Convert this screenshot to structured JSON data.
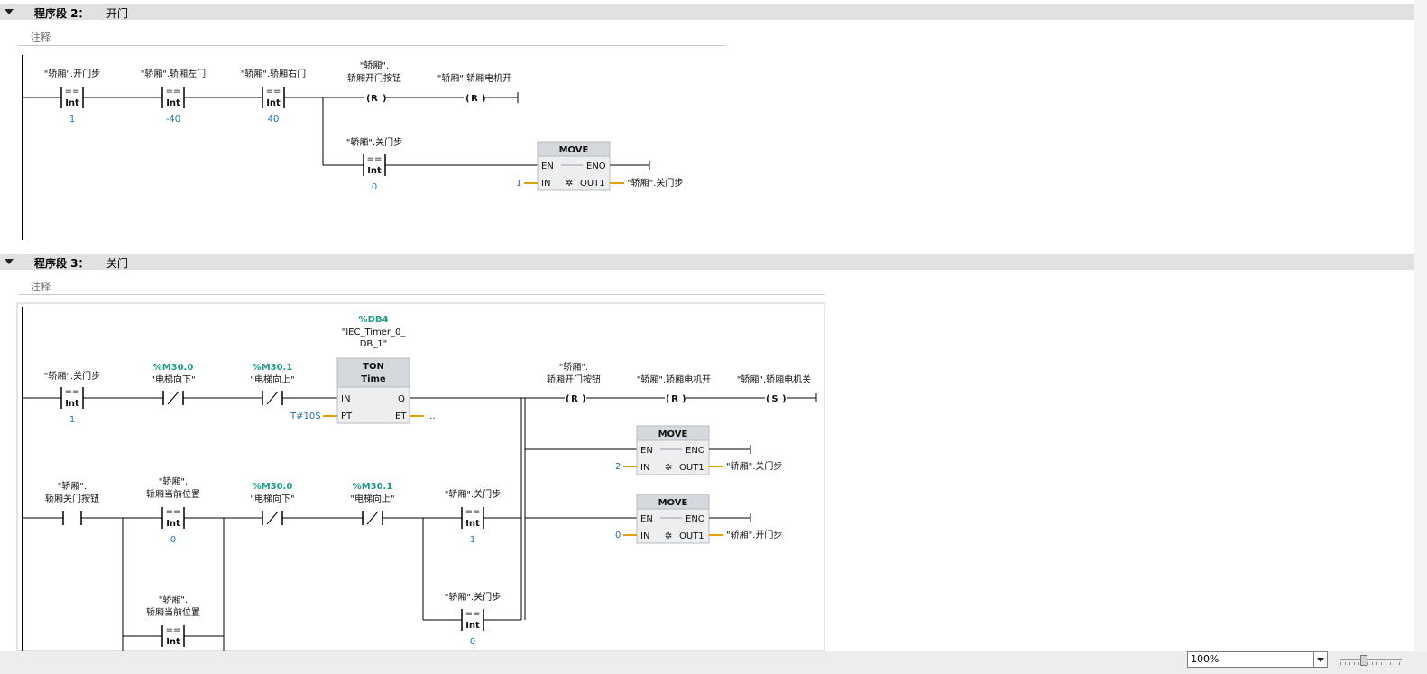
{
  "networks": [
    {
      "title": "程序段 2：",
      "name": "开门",
      "comment_placeholder": "注释"
    },
    {
      "title": "程序段 3：",
      "name": "关门",
      "comment_placeholder": "注释"
    }
  ],
  "n2": {
    "c1_tag": "\"轿厢\".开门步",
    "c1_op": "==",
    "c1_type": "Int",
    "c1_val": "1",
    "c2_tag": "\"轿厢\".轿厢左门",
    "c2_op": "==",
    "c2_type": "Int",
    "c2_val": "-40",
    "c3_tag": "\"轿厢\".轿厢右门",
    "c3_op": "==",
    "c3_type": "Int",
    "c3_val": "40",
    "coil1_tag_l1": "\"轿厢\".",
    "coil1_tag_l2": "轿厢开门按钮",
    "coil1_type": "R",
    "coil2_tag": "\"轿厢\".轿厢电机开",
    "coil2_type": "R",
    "c4_tag": "\"轿厢\".关门步",
    "c4_op": "==",
    "c4_type": "Int",
    "c4_val": "0",
    "move_title": "MOVE",
    "move_en": "EN",
    "move_eno": "ENO",
    "move_in": "IN",
    "move_out": "OUT1",
    "move_in_val": "1",
    "move_out_tag": "\"轿厢\".关门步"
  },
  "n3": {
    "c1_tag": "\"轿厢\".关门步",
    "c1_op": "==",
    "c1_type": "Int",
    "c1_val": "1",
    "nc1_addr": "%M30.0",
    "nc1_tag": "\"电梯向下\"",
    "nc2_addr": "%M30.1",
    "nc2_tag": "\"电梯向上\"",
    "timer_db": "%DB4",
    "timer_inst_l1": "\"IEC_Timer_0_",
    "timer_inst_l2": "DB_1\"",
    "timer_type": "TON",
    "timer_sub": "Time",
    "timer_in": "IN",
    "timer_q": "Q",
    "timer_pt": "PT",
    "timer_et": "ET",
    "timer_pt_val": "T#10S",
    "timer_et_val": "...",
    "coil1_tag_l1": "\"轿厢\".",
    "coil1_tag_l2": "轿厢开门按钮",
    "coil1_type": "R",
    "coil2_tag": "\"轿厢\".轿厢电机开",
    "coil2_type": "R",
    "coil3_tag": "\"轿厢\".轿厢电机关",
    "coil3_type": "S",
    "move1_title": "MOVE",
    "move1_in_val": "2",
    "move1_out_tag": "\"轿厢\".关门步",
    "move2_title": "MOVE",
    "move2_in_val": "0",
    "move2_out_tag": "\"轿厢\".开门步",
    "move_en": "EN",
    "move_eno": "ENO",
    "move_in": "IN",
    "move_out": "OUT1",
    "no1_tag_l1": "\"轿厢\".",
    "no1_tag_l2": "轿厢关门按钮",
    "c2_tag_l1": "\"轿厢\".",
    "c2_tag_l2": "轿厢当前位置",
    "c2_op": "==",
    "c2_type": "Int",
    "c2_val": "0",
    "nc3_addr": "%M30.0",
    "nc3_tag": "\"电梯向下\"",
    "nc4_addr": "%M30.1",
    "nc4_tag": "\"电梯向上\"",
    "c3_tag": "\"轿厢\".关门步",
    "c3_op": "==",
    "c3_type": "Int",
    "c3_val": "1",
    "c4_tag_l1": "\"轿厢\".",
    "c4_tag_l2": "轿厢当前位置",
    "c4_op": "==",
    "c4_type": "Int",
    "c5_tag": "\"轿厢\".关门步",
    "c5_op": "==",
    "c5_type": "Int",
    "c5_val": "0"
  },
  "statusbar": {
    "zoom": "100%"
  }
}
